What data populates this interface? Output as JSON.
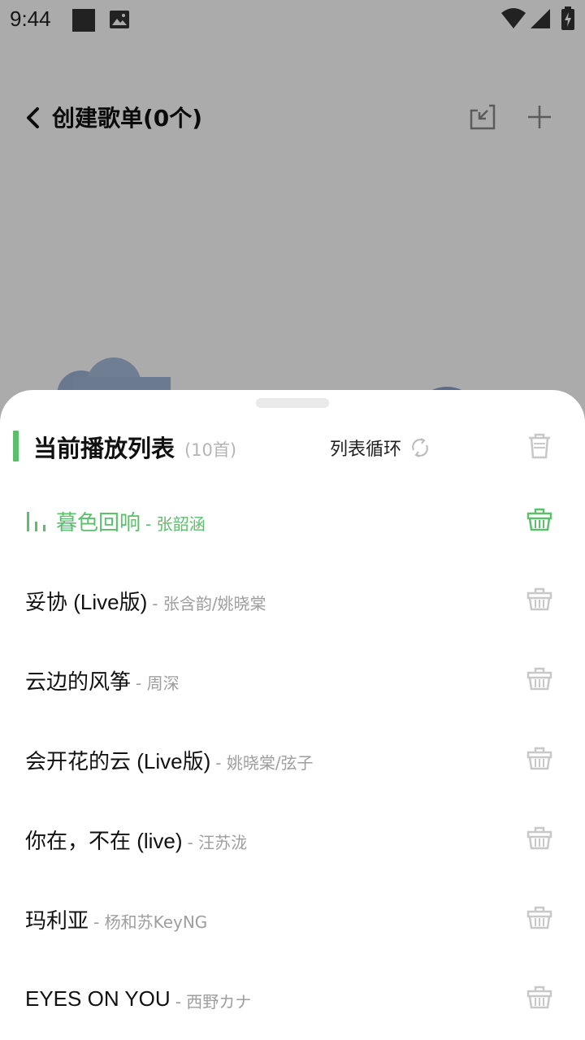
{
  "status_bar": {
    "time": "9:44"
  },
  "background_page": {
    "title": "创建歌单(0个)"
  },
  "colors": {
    "accent": "#5cbf6b",
    "muted_icon": "#c8c8c8"
  },
  "sheet": {
    "title": "当前播放列表",
    "count": "(10首)",
    "play_mode": "列表循环",
    "icons": {
      "play_mode": "loop-icon",
      "clear": "trash-icon",
      "item_action": "basket-icon",
      "playing": "equalizer-icon"
    },
    "songs": [
      {
        "name": "暮色回响",
        "artist": "- 张韶涵",
        "playing": true
      },
      {
        "name": "妥协 (Live版)",
        "artist": "- 张含韵/姚晓棠",
        "playing": false
      },
      {
        "name": "云边的风筝",
        "artist": "- 周深",
        "playing": false
      },
      {
        "name": "会开花的云 (Live版)",
        "artist": "- 姚晓棠/弦子",
        "playing": false
      },
      {
        "name": "你在，不在 (live)",
        "artist": "- 汪苏泷",
        "playing": false
      },
      {
        "name": "玛利亚",
        "artist": "- 杨和苏KeyNG",
        "playing": false
      },
      {
        "name": "EYES ON YOU",
        "artist": "- 西野カナ",
        "playing": false
      }
    ]
  }
}
